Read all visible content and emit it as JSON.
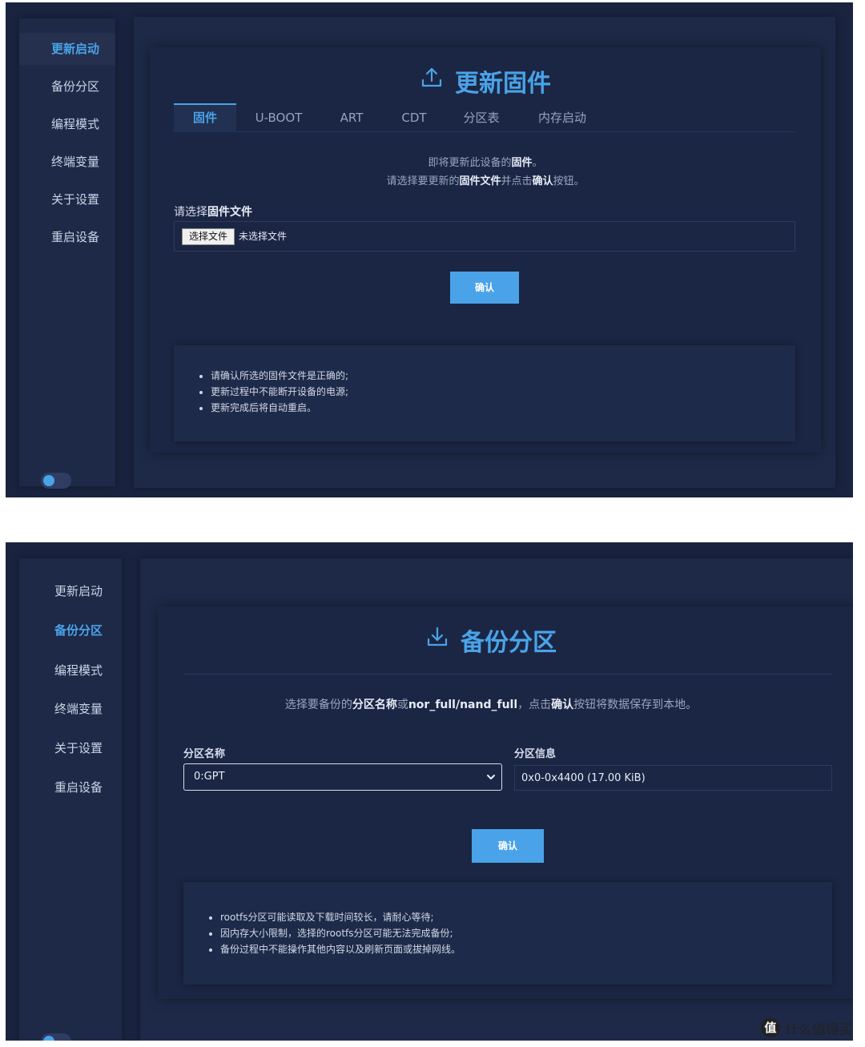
{
  "screen1": {
    "nav": [
      "更新启动",
      "备份分区",
      "编程模式",
      "终端变量",
      "关于设置",
      "重启设备"
    ],
    "title": "更新固件",
    "tabs": [
      "固件",
      "U-BOOT",
      "ART",
      "CDT",
      "分区表",
      "内存启动"
    ],
    "desc_line1_pre": "即将更新此设备的",
    "desc_line1_bold": "固件",
    "desc_line1_post": "。",
    "desc_line2_pre": "请选择要更新的",
    "desc_line2_bold1": "固件文件",
    "desc_line2_mid": "并点击",
    "desc_line2_bold2": "确认",
    "desc_line2_post": "按钮。",
    "field_label_pre": "请选择",
    "field_label_bold": "固件文件",
    "file_button": "选择文件",
    "file_status": "未选择文件",
    "confirm": "确认",
    "notes": [
      "请确认所选的固件文件是正确的;",
      "更新过程中不能断开设备的电源;",
      "更新完成后将自动重启。"
    ]
  },
  "screen2": {
    "nav": [
      "更新启动",
      "备份分区",
      "编程模式",
      "终端变量",
      "关于设置",
      "重启设备"
    ],
    "title": "备份分区",
    "desc_pre": "选择要备份的",
    "desc_bold1": "分区名称",
    "desc_mid1": "或",
    "desc_bold2": "nor_full/nand_full",
    "desc_mid2": "，点击",
    "desc_bold3": "确认",
    "desc_post": "按钮将数据保存到本地。",
    "partition_label": "分区名称",
    "partition_value": "0:GPT",
    "info_label": "分区信息",
    "info_value": "0x0-0x4400 (17.00 KiB)",
    "confirm": "确认",
    "notes": [
      "rootfs分区可能读取及下载时间较长，请耐心等待;",
      "因内存大小限制，选择的rootfs分区可能无法完成备份;",
      "备份过程中不能操作其他内容以及刷新页面或拔掉网线。"
    ]
  },
  "watermark": {
    "logo": "值",
    "text": "什么值得买"
  },
  "colors": {
    "accent": "#4aa3e8",
    "background": "#1a2440",
    "card": "#1b2644"
  }
}
